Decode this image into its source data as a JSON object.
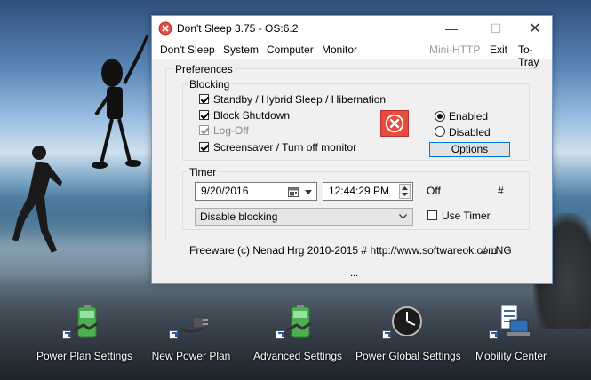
{
  "window": {
    "title": "Don't Sleep 3.75 - OS:6.2",
    "controls": {
      "minimize": "—",
      "maximize": "☐",
      "close": "✕"
    }
  },
  "menu": {
    "dont_sleep": "Don't Sleep",
    "system": "System",
    "computer": "Computer",
    "monitor": "Monitor",
    "mini_http": "Mini-HTTP",
    "exit": "Exit",
    "to_tray": "To-Tray"
  },
  "preferences": {
    "label": "Preferences",
    "blocking": {
      "label": "Blocking",
      "items": [
        {
          "label": "Standby / Hybrid Sleep / Hibernation",
          "checked": true,
          "enabled": true
        },
        {
          "label": "Block Shutdown",
          "checked": true,
          "enabled": true
        },
        {
          "label": "Log-Off",
          "checked": true,
          "enabled": false
        },
        {
          "label": "Screensaver / Turn off monitor",
          "checked": true,
          "enabled": true
        }
      ],
      "enabled_label": "Enabled",
      "disabled_label": "Disabled",
      "selected": "Enabled",
      "options_button": "Options"
    }
  },
  "timer": {
    "label": "Timer",
    "date": "9/20/2016",
    "time": "12:44:29 PM",
    "status": "Off",
    "hash": "#",
    "action": "Disable blocking",
    "use_timer_label": "Use Timer",
    "use_timer_checked": false
  },
  "footer": {
    "text": "Freeware (c) Nenad Hrg 2010-2015 # http://www.softwareok.com",
    "lng": "# LNG",
    "ellipsis": "..."
  },
  "desktop_icons": [
    {
      "label": "Power Plan Settings",
      "icon": "battery-plug-icon"
    },
    {
      "label": "New Power Plan",
      "icon": "power-plug-icon"
    },
    {
      "label": "Advanced Settings",
      "icon": "battery-plug-icon"
    },
    {
      "label": "Power Global Settings",
      "icon": "clock-icon"
    },
    {
      "label": "Mobility Center",
      "icon": "mobility-center-icon"
    }
  ],
  "colors": {
    "accent": "#0078d7",
    "stop_icon": "#e74c3c",
    "battery": "#4caf50"
  }
}
